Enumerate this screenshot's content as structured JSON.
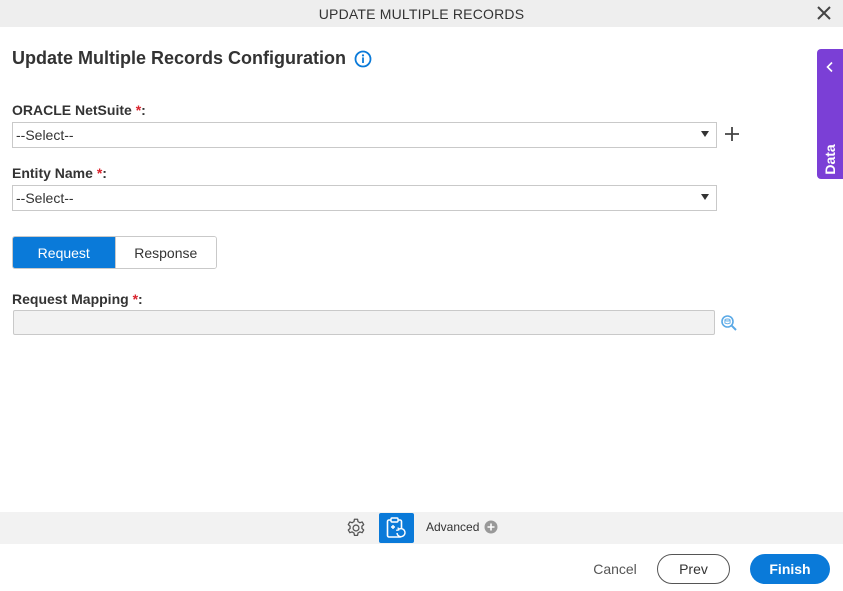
{
  "window": {
    "title": "UPDATE MULTIPLE RECORDS",
    "close_icon": "close-icon"
  },
  "heading": {
    "text": "Update Multiple Records Configuration",
    "info_icon": "info-icon"
  },
  "fields": {
    "oracle_netsuite": {
      "label": "ORACLE NetSuite",
      "required_mark": "*",
      "suffix": ":",
      "value": "--Select--"
    },
    "entity_name": {
      "label": "Entity Name",
      "required_mark": "*",
      "suffix": ":",
      "value": "--Select--"
    },
    "request_mapping": {
      "label": "Request Mapping",
      "required_mark": "*",
      "suffix": ":",
      "value": ""
    }
  },
  "tabs": {
    "request": "Request",
    "response": "Response",
    "active": "request"
  },
  "side_panel": {
    "label": "App Data"
  },
  "toolbar": {
    "advanced_label": "Advanced"
  },
  "footer": {
    "cancel": "Cancel",
    "prev": "Prev",
    "finish": "Finish"
  },
  "colors": {
    "primary": "#0a7ad9",
    "side_tab": "#7b3fd6",
    "required": "#d9232d",
    "titlebar": "#eeeeee"
  }
}
